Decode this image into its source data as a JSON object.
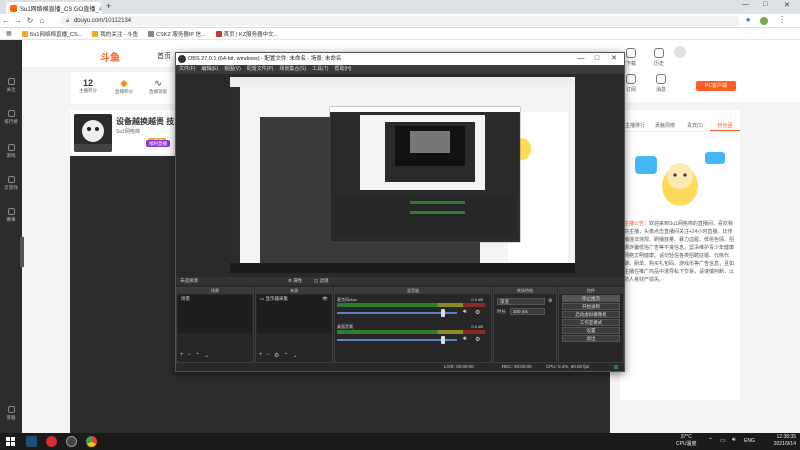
{
  "browser": {
    "tab_title": "Su1网络棉直播_CS:GO直播_斗鱼",
    "new_tab": "+",
    "window_controls": {
      "minimize": "—",
      "maximize": "□",
      "close": "✕"
    },
    "url": "douyu.com/10112134",
    "bookmarks": [
      "Su1网络棉直播_CS...",
      "我的关注 - 斗鱼",
      "CSKZ 服务器IP 信...",
      "首页 | KZ服务器中文..."
    ]
  },
  "site": {
    "logo": "斗鱼",
    "nav_home": "首页",
    "left_nav": [
      "关注",
      "排行榜",
      "游戏",
      "云游戏",
      "赛事",
      "客服"
    ],
    "stats": [
      {
        "value": "12",
        "label": "主播积分"
      },
      {
        "value": "",
        "label": "直播积分"
      },
      {
        "value": "",
        "label": "直播等级"
      }
    ],
    "room_title": "设备越换越贵 技术",
    "room_name": "Su1网络棉",
    "room_badge": "V直播",
    "room_button": "福利直播",
    "header_icons": [
      "下载",
      "历史",
      "任务",
      "订阅",
      "消息",
      "鱼吧"
    ],
    "pc_button": "PC客户端",
    "right_tabs": [
      "主播排行",
      "贡献周榜",
      "贵宾(1)",
      "粉丝团"
    ],
    "announcement_highlight": "主播公告：",
    "announcement": "欢迎来到Su1网络棉的直播间，喜欢我的主播，头像点击直播间关注+24小时直播。比传播违法违规、刷播放量、暴力血腥、低俗色情、招嫖诈骗低俗广告等不良信息，坚决维护青少年健康网络文明健康。请勿轻信各类招聘征婚、代练代聊、刷单、购买礼包码、游戏币等广告信息，且如主播在推广商品中诱导私下交易，请谨慎判断，以防人身财产损失。"
  },
  "obs": {
    "title": "OBS 27.0.1 (64-bit, windows) - 配置文件: 未命名 - 场景: 未命名",
    "menu": [
      "文件(F)",
      "编辑(E)",
      "视图(V)",
      "配置文件(P)",
      "场景集合(S)",
      "工具(T)",
      "帮助(H)"
    ],
    "strip_label": "未选择源",
    "strip_props": "属性",
    "strip_filters": "滤镜",
    "scenes_title": "场景",
    "scene_item": "场景",
    "sources_title": "来源",
    "source_item": "显示器采集",
    "mixer_title": "混音器",
    "mixer_tracks": [
      {
        "name": "麦克风/Aux",
        "db": "0.0 dB"
      },
      {
        "name": "桌面音频",
        "db": "0.0 dB"
      }
    ],
    "transitions_title": "转场特效",
    "transition_type": "渐变",
    "duration_label": "时长",
    "duration_value": "300 ms",
    "controls_title": "控件",
    "controls": [
      "停止推流",
      "开始录制",
      "启动虚拟摄像机",
      "工作室模式",
      "设置",
      "退出"
    ],
    "status": {
      "live": "LIVE: 00:00:00",
      "rec": "REC: 00:00:00",
      "cpu": "CPU: 0.4%, 60.00 fps"
    }
  },
  "taskbar": {
    "weather": "37°C",
    "weather_label": "CPU温度",
    "lang": "ENG",
    "time": "12:38:35",
    "date": "2021/9/14"
  },
  "colors": {
    "brand": "#ff5d23",
    "obs_bg": "#2a2a2a",
    "taskbar": "#1b1b1b"
  }
}
